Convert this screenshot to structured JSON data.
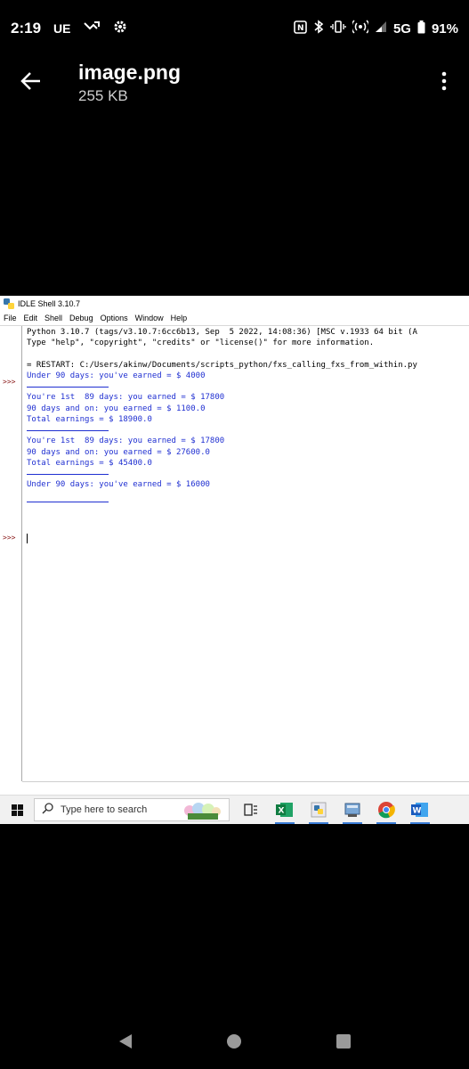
{
  "status_bar": {
    "time": "2:19",
    "carrier_badge": "UE",
    "network": "5G",
    "battery": "91%"
  },
  "viewer": {
    "file_name": "image.png",
    "file_size": "255 KB"
  },
  "idle": {
    "title": "IDLE Shell 3.10.7",
    "menu": [
      "File",
      "Edit",
      "Shell",
      "Debug",
      "Options",
      "Window",
      "Help"
    ],
    "prompt": ">>>",
    "lines": {
      "l1": "Python 3.10.7 (tags/v3.10.7:6cc6b13, Sep  5 2022, 14:08:36) [MSC v.1933 64 bit (A",
      "l2": "Type \"help\", \"copyright\", \"credits\" or \"license()\" for more information.",
      "l3": "= RESTART: C:/Users/akinw/Documents/scripts_python/fxs_calling_fxs_from_within.py",
      "l4": "Under 90 days: you've earned = $ 4000",
      "l5": "You're 1st  89 days: you earned = $ 17800",
      "l6": "90 days and on: you earned = $ 1100.0",
      "l7": "Total earnings = $ 18900.0",
      "l8": "You're 1st  89 days: you earned = $ 17800",
      "l9": "90 days and on: you earned = $ 27600.0",
      "l10": "Total earnings = $ 45400.0",
      "l11": "Under 90 days: you've earned = $ 16000"
    }
  },
  "taskbar": {
    "search_placeholder": "Type here to search"
  },
  "colors": {
    "output_blue": "#1f2fd1",
    "prompt_red": "#8b1a1a",
    "taskbar_bg": "#f1f1f1"
  }
}
